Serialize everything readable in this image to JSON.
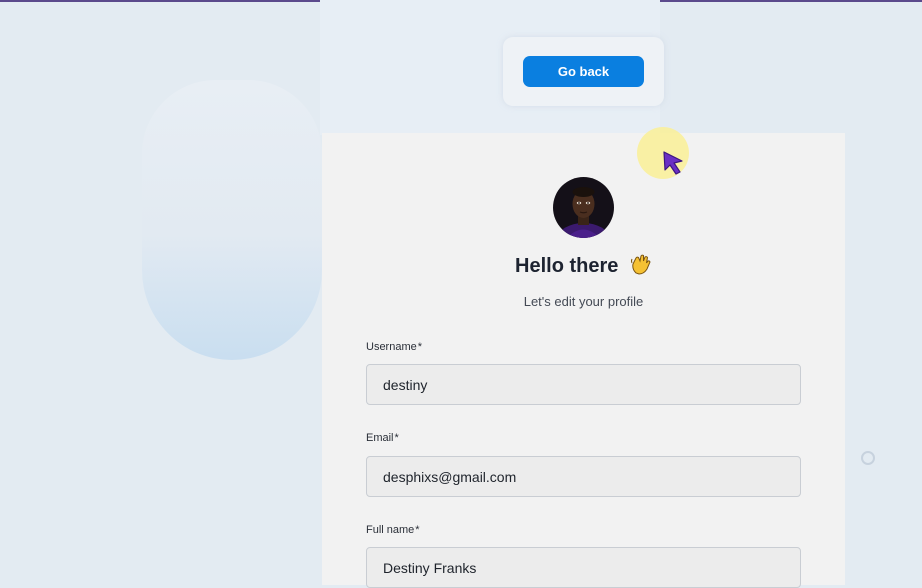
{
  "nav": {
    "go_back_label": "Go back"
  },
  "profile": {
    "greeting": "Hello there",
    "greeting_icon": "waving-hand-icon",
    "subtitle": "Let's edit your profile",
    "avatar": "user-avatar-photo"
  },
  "form": {
    "required_marker": "*",
    "username": {
      "label": "Username",
      "value": "destiny"
    },
    "email": {
      "label": "Email",
      "value": "desphixs@gmail.com"
    },
    "full_name": {
      "label": "Full name",
      "value": "Destiny Franks"
    }
  },
  "colors": {
    "accent": "#0a7fe0",
    "page_background": "#e3ebf2",
    "card_background": "#f2f2f2",
    "cursor": "#6a2fc4",
    "cursor_highlight": "#f5ec8c"
  },
  "icons": [
    "pointer-cursor-icon",
    "waving-hand-icon",
    "ring-icon"
  ]
}
